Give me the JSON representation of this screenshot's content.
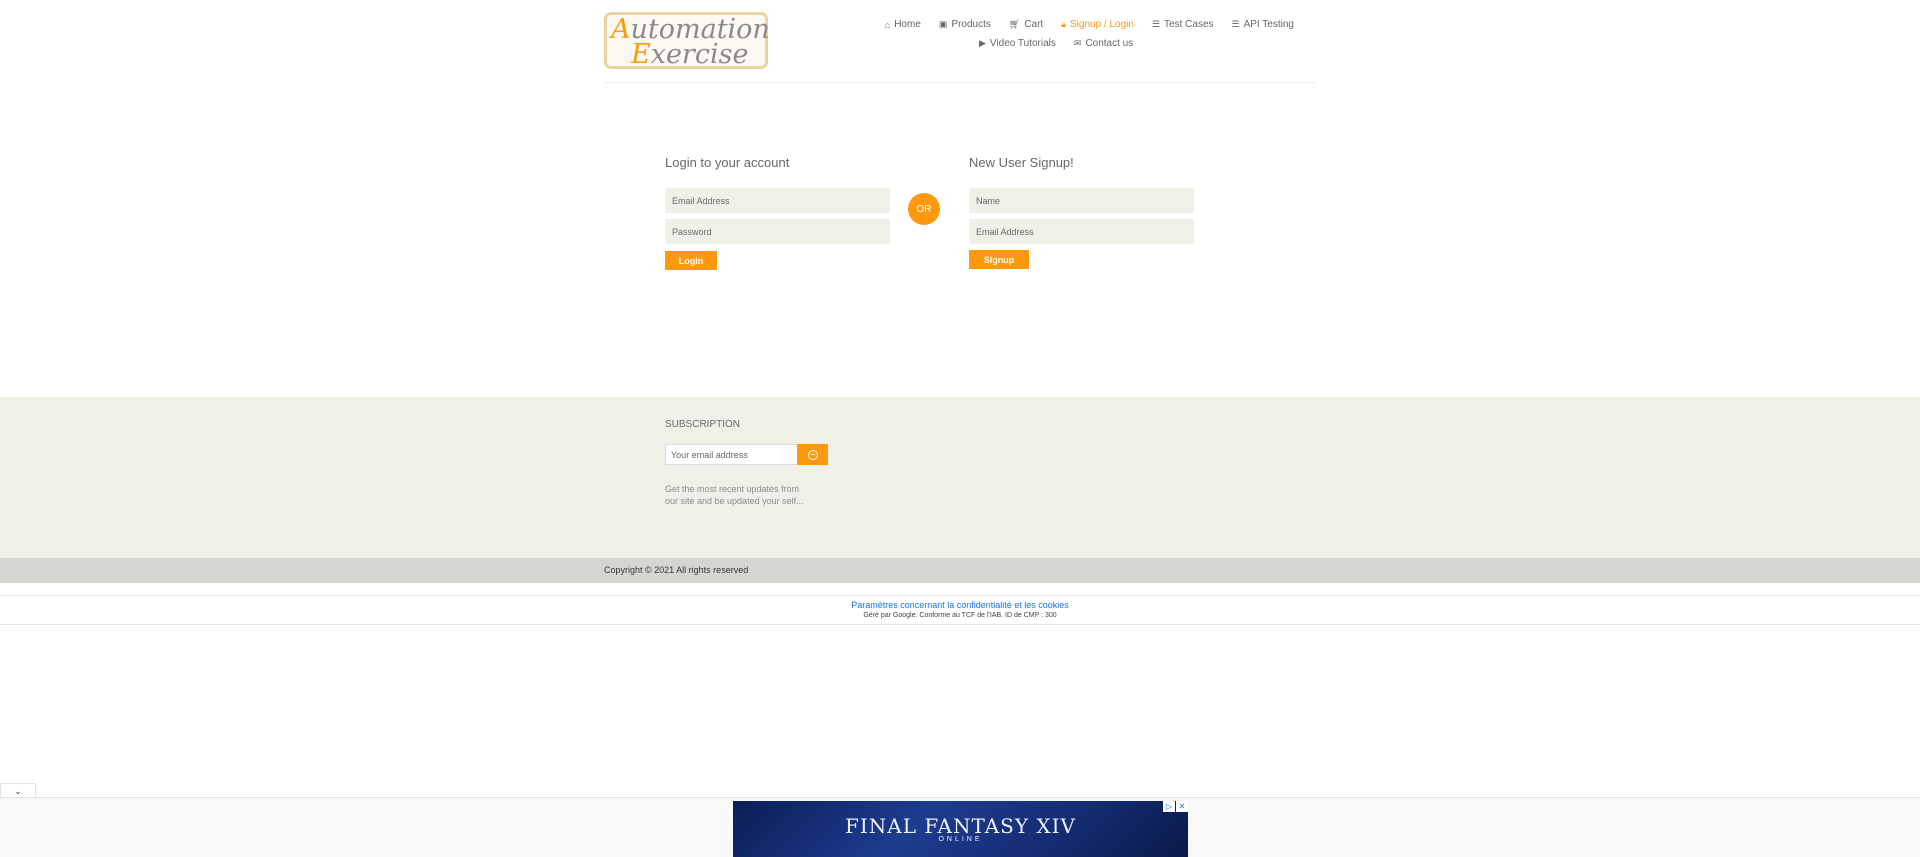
{
  "header": {
    "logo_line1": "utomation",
    "logo_cap1": "A",
    "logo_line2": "xercise",
    "logo_cap2": "E",
    "nav": [
      {
        "label": "Home",
        "icon": "home-icon"
      },
      {
        "label": "Products",
        "icon": "products-icon"
      },
      {
        "label": "Cart",
        "icon": "cart-icon"
      },
      {
        "label": "Signup / Login",
        "icon": "lock-icon",
        "active": true
      },
      {
        "label": "Test Cases",
        "icon": "list-icon"
      },
      {
        "label": "API Testing",
        "icon": "list-icon"
      },
      {
        "label": "Video Tutorials",
        "icon": "youtube-icon"
      },
      {
        "label": "Contact us",
        "icon": "envelope-icon"
      }
    ]
  },
  "login": {
    "title": "Login to your account",
    "email_placeholder": "Email Address",
    "password_placeholder": "Password",
    "button": "Login"
  },
  "or_label": "OR",
  "signup": {
    "title": "New User Signup!",
    "name_placeholder": "Name",
    "email_placeholder": "Email Address",
    "button": "Signup"
  },
  "subscription": {
    "title": "SUBSCRIPTION",
    "placeholder": "Your email address",
    "description": "Get the most recent updates from our site and be updated your self..."
  },
  "footer": {
    "copyright": "Copyright © 2021 All rights reserved"
  },
  "consent": {
    "link": "Paramètres concernant la confidentialité et les cookies",
    "sub": "Géré par Google. Conforme au TCF de l'IAB. ID de CMP : 300"
  },
  "ad": {
    "title": "FINAL FANTASY XIV",
    "subtitle": "ONLINE"
  },
  "colors": {
    "accent": "#fe980f",
    "panel": "#f0f0e9",
    "text": "#696763"
  }
}
